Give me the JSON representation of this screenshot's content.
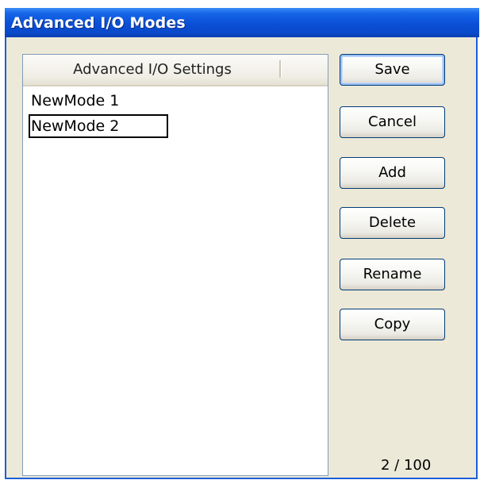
{
  "window": {
    "title": "Advanced I/O Modes"
  },
  "list": {
    "column_header": "Advanced I/O Settings",
    "items": [
      {
        "label": "NewMode  1",
        "selected": false
      },
      {
        "label": "NewMode  2",
        "selected": true
      }
    ]
  },
  "buttons": {
    "save": "Save",
    "cancel": "Cancel",
    "add": "Add",
    "delete": "Delete",
    "rename": "Rename",
    "copy": "Copy"
  },
  "status": {
    "count": "2 / 100"
  },
  "colors": {
    "titlebar": "#0a4fd6",
    "dialog_bg": "#ece9d8",
    "button_border": "#003c74"
  }
}
